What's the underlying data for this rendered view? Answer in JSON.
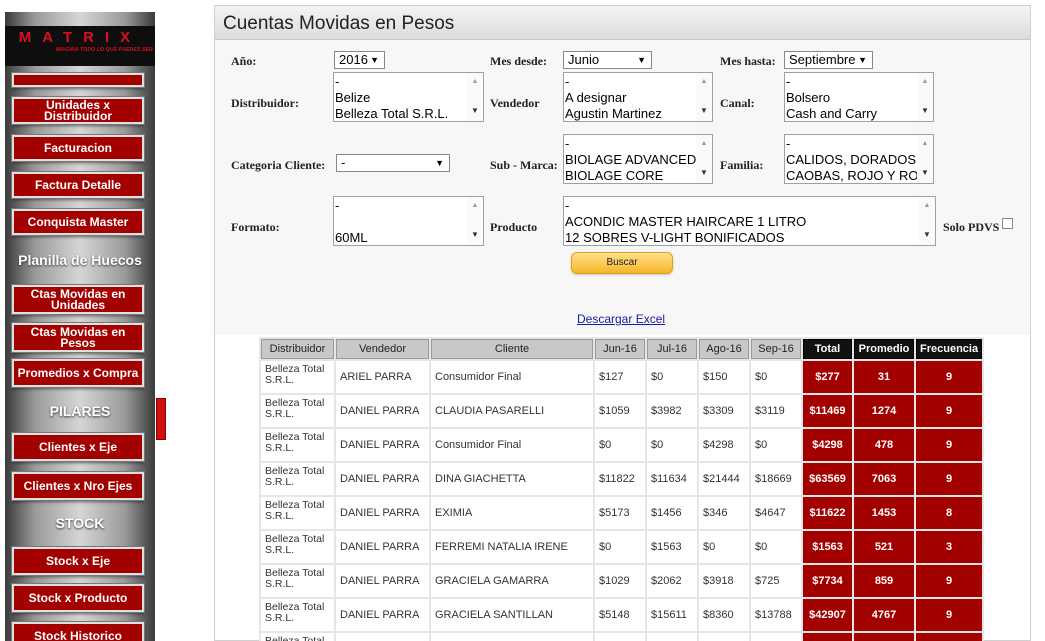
{
  "sidebar": {
    "logo": {
      "brand": "MATRIX",
      "tagline": "IMAGINA TODO LO QUE PUEDES SER"
    },
    "items": [
      {
        "type": "button",
        "label": ""
      },
      {
        "type": "button",
        "label": "Unidades x Distribuidor"
      },
      {
        "type": "button",
        "label": "Facturacion"
      },
      {
        "type": "button",
        "label": "Factura Detalle"
      },
      {
        "type": "button",
        "label": "Conquista Master"
      },
      {
        "type": "heading",
        "label": "Planilla de Huecos"
      },
      {
        "type": "button",
        "label": "Ctas Movidas en Unidades"
      },
      {
        "type": "button",
        "label": "Ctas Movidas en Pesos"
      },
      {
        "type": "button",
        "label": "Promedios x Compra"
      },
      {
        "type": "heading",
        "label": "PILARES"
      },
      {
        "type": "button",
        "label": "Clientes x Eje"
      },
      {
        "type": "button",
        "label": "Clientes x Nro Ejes"
      },
      {
        "type": "heading",
        "label": "STOCK"
      },
      {
        "type": "button",
        "label": "Stock x Eje"
      },
      {
        "type": "button",
        "label": "Stock x Producto"
      },
      {
        "type": "button",
        "label": "Stock Historico"
      }
    ]
  },
  "page": {
    "title": "Cuentas Movidas en Pesos"
  },
  "filters": {
    "anio": {
      "label": "Año:",
      "value": "2016"
    },
    "mes_desde": {
      "label": "Mes desde:",
      "value": "Junio"
    },
    "mes_hasta": {
      "label": "Mes hasta:",
      "value": "Septiembre"
    },
    "distribuidor": {
      "label": "Distribuidor:",
      "options": [
        "-",
        "Belize",
        "Belleza Total S.R.L."
      ]
    },
    "vendedor": {
      "label": "Vendedor",
      "options": [
        "-",
        "A designar",
        "Agustin Martinez"
      ]
    },
    "canal": {
      "label": "Canal:",
      "options": [
        "-",
        "Bolsero",
        "Cash and Carry"
      ]
    },
    "categoria": {
      "label": "Categoria Cliente:",
      "value": "-"
    },
    "sub_marca": {
      "label": "Sub - Marca:",
      "options": [
        "-",
        "BIOLAGE ADVANCED",
        "BIOLAGE CORE"
      ]
    },
    "familia": {
      "label": "Familia:",
      "options": [
        "-",
        "CALIDOS, DORADOS",
        "CAOBAS, ROJO Y RO"
      ]
    },
    "formato": {
      "label": "Formato:",
      "options": [
        "-",
        "",
        "60ML"
      ]
    },
    "producto": {
      "label": "Producto",
      "options": [
        "-",
        "ACONDIC MASTER HAIRCARE 1 LITRO",
        "12 SOBRES V-LIGHT BONIFICADOS"
      ]
    },
    "solo_pdvs": {
      "label": "Solo PDVS",
      "checked": false
    },
    "buscar_label": "Buscar",
    "excel_label": "Descargar Excel"
  },
  "table": {
    "headers": [
      "Distribuidor",
      "Vendedor",
      "Cliente",
      "Jun-16",
      "Jul-16",
      "Ago-16",
      "Sep-16",
      "Total",
      "Promedio",
      "Frecuencia"
    ],
    "rows": [
      [
        "Belleza Total S.R.L.",
        "ARIEL PARRA",
        "Consumidor Final",
        "$127",
        "$0",
        "$150",
        "$0",
        "$277",
        "31",
        "9"
      ],
      [
        "Belleza Total S.R.L.",
        "DANIEL PARRA",
        "CLAUDIA PASARELLI",
        "$1059",
        "$3982",
        "$3309",
        "$3119",
        "$11469",
        "1274",
        "9"
      ],
      [
        "Belleza Total S.R.L.",
        "DANIEL PARRA",
        "Consumidor Final",
        "$0",
        "$0",
        "$4298",
        "$0",
        "$4298",
        "478",
        "9"
      ],
      [
        "Belleza Total S.R.L.",
        "DANIEL PARRA",
        "DINA GIACHETTA",
        "$11822",
        "$11634",
        "$21444",
        "$18669",
        "$63569",
        "7063",
        "9"
      ],
      [
        "Belleza Total S.R.L.",
        "DANIEL PARRA",
        "EXIMIA",
        "$5173",
        "$1456",
        "$346",
        "$4647",
        "$11622",
        "1453",
        "8"
      ],
      [
        "Belleza Total S.R.L.",
        "DANIEL PARRA",
        "FERREMI NATALIA IRENE",
        "$0",
        "$1563",
        "$0",
        "$0",
        "$1563",
        "521",
        "3"
      ],
      [
        "Belleza Total S.R.L.",
        "DANIEL PARRA",
        "GRACIELA GAMARRA",
        "$1029",
        "$2062",
        "$3918",
        "$725",
        "$7734",
        "859",
        "9"
      ],
      [
        "Belleza Total S.R.L.",
        "DANIEL PARRA",
        "GRACIELA SANTILLAN",
        "$5148",
        "$15611",
        "$8360",
        "$13788",
        "$42907",
        "4767",
        "9"
      ],
      [
        "Belleza Total",
        "",
        "",
        "",
        "",
        "",
        "",
        "",
        "",
        ""
      ]
    ]
  }
}
